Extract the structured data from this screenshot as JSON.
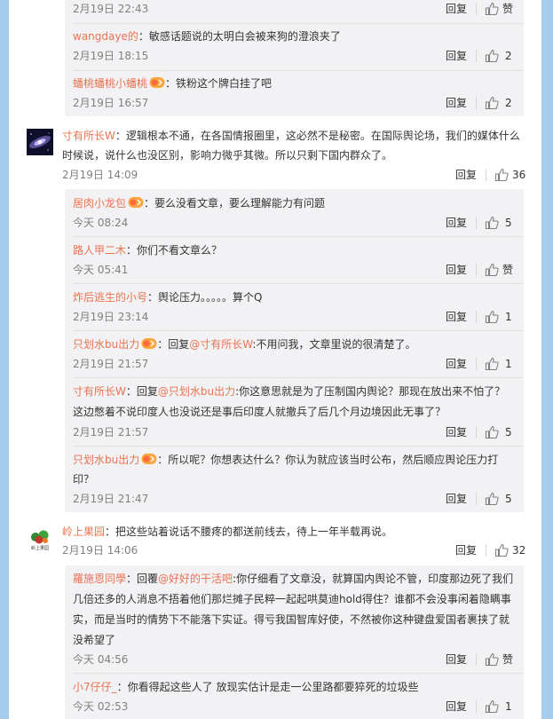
{
  "actions": {
    "reply": "回复",
    "like": "赞"
  },
  "comments": {
    "c0": {
      "time": "2月19日 22:43",
      "likes": "赞"
    },
    "c1": {
      "name": "wangdaye的",
      "text": "：敏感话题说的太明白会被来狗的澄浪夹了",
      "time": "2月19日 18:15",
      "likes": "2"
    },
    "c2": {
      "name": "蟠桃蟠桃小蟠桃",
      "text": "：铁粉这个牌白挂了吧",
      "time": "2月19日 16:57",
      "likes": "2"
    },
    "t1": {
      "name": "寸有所长W",
      "text_line1": "：逻辑根本不通，在各国情报圈里，这必然不是秘密。在国际舆论场，我们的媒体什么",
      "text_line2": "时候说，说什么也没区别，影响力微乎其微。所以只剩下国内群众了。",
      "time": "2月19日 14:09",
      "likes": "36"
    },
    "r1": {
      "name": "居肉小龙包",
      "text": "：要么没看文章，要么理解能力有问题",
      "time": "今天 08:24",
      "likes": "5"
    },
    "r2": {
      "name": "路人甲二木",
      "text": "：你们不看文章么？",
      "time": "今天 05:41",
      "likes": "赞"
    },
    "r3": {
      "name": "炸后逃生的小号",
      "text": "：舆论压力。。。。。算个Q",
      "time": "2月19日 23:14",
      "likes": "1"
    },
    "r4": {
      "name": "只划水bu出力",
      "text_a": "：回复",
      "mention": "@寸有所长W",
      "text_b": ":不用问我，文章里说的很清楚了。",
      "time": "2月19日 21:57",
      "likes": "1"
    },
    "r5": {
      "name": "寸有所长W",
      "text_a": "：回复",
      "mention": "@只划水bu出力",
      "text_b": ":你这意思就是为了压制国内舆论？那现在放出来不怕了？",
      "text_line2": "这边憋着不说印度人也没说还是事后印度人就撤兵了后几个月边境因此无事了？",
      "time": "2月19日 21:57",
      "likes": "5"
    },
    "r6": {
      "name": "只划水bu出力",
      "text_line1": "：所以呢？你想表达什么？你认为就应该当时公布，然后顺应舆论压力打",
      "text_line2": "印？",
      "time": "2月19日 21:47",
      "likes": "5"
    },
    "t2": {
      "name": "岭上果园",
      "avatar_caption": "岭上果园",
      "text": "：把这些站着说话不腰疼的都送前线去，待上一年半载再说。",
      "time": "2月19日 14:06",
      "likes": "32"
    },
    "r7": {
      "name": "羅施恩同學",
      "text_a": "：回覆",
      "mention": "@好好的干活吧",
      "text_b": ":你仔细看了文章没，就算国内舆论不管，印度那边死了我们",
      "text_line2": "几倍还多的人消息不捂着他们那烂摊子民粹一起起哄莫迪hold得住？谁都不会没事闲着隐瞒事",
      "text_line3": "实，而是当时的情势下不能落下实证。得亏我国智库好使，不然被你这种键盘爱国者裹挟了就",
      "text_line4": "没希望了",
      "time": "今天 04:56",
      "likes": "赞"
    },
    "r8": {
      "name": "小7仔仔_",
      "text": "：你看得起这些人了 放现实估计是走一公里路都要猝死的垃圾些",
      "time": "今天 02:53",
      "likes": "1"
    }
  },
  "colors": {
    "accent": "#eb7350",
    "edge": "#a7cdee",
    "subpanel": "#f2f2f5",
    "meta": "#808080"
  }
}
